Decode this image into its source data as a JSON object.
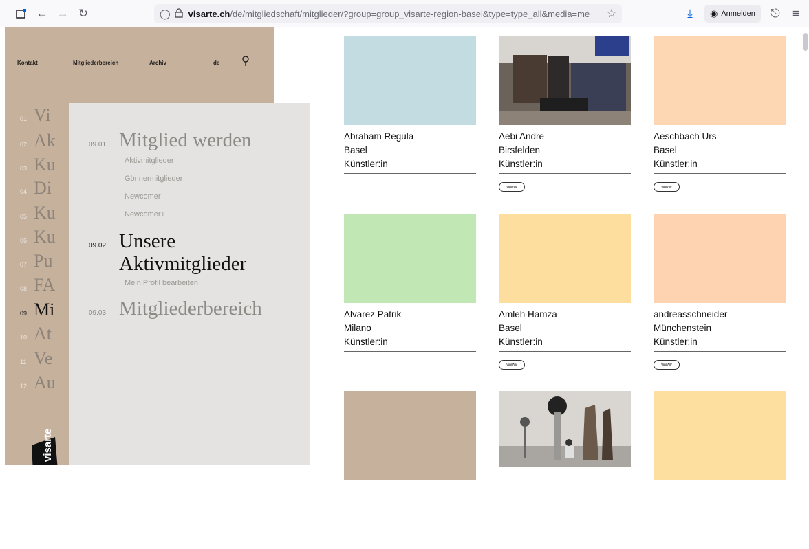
{
  "browser": {
    "url_host": "visarte.ch",
    "url_path": "/de/mitgliedschaft/mitglieder/?group=group_visarte-region-basel&type=type_all&media=me",
    "signin_label": "Anmelden"
  },
  "topnav": {
    "kontakt": "Kontakt",
    "mitgliederbereich": "Mitgliederbereich",
    "archiv": "Archiv",
    "lang": "de"
  },
  "menu": [
    {
      "num": "01",
      "label": "Vi"
    },
    {
      "num": "02",
      "label": "Ak"
    },
    {
      "num": "03",
      "label": "Ku"
    },
    {
      "num": "04",
      "label": "Di"
    },
    {
      "num": "05",
      "label": "Ku"
    },
    {
      "num": "06",
      "label": "Ku"
    },
    {
      "num": "07",
      "label": "Pu"
    },
    {
      "num": "08",
      "label": "FA"
    },
    {
      "num": "09",
      "label": "Mi"
    },
    {
      "num": "10",
      "label": "At"
    },
    {
      "num": "11",
      "label": "Ve"
    },
    {
      "num": "12",
      "label": "Au"
    }
  ],
  "logo_text": "visarte",
  "submenu": {
    "s1": {
      "num": "09.01",
      "label": "Mitglied werden"
    },
    "s1_items": [
      "Aktivmitglieder",
      "Gönnermitglieder",
      "Newcomer",
      "Newcomer+"
    ],
    "s2": {
      "num": "09.02",
      "label_line1": "Unsere",
      "label_line2": "Aktivmitglieder"
    },
    "s2_items": [
      "Mein Profil bearbeiten"
    ],
    "s3": {
      "num": "09.03",
      "label": "Mitgliederbereich"
    }
  },
  "members": [
    {
      "name": "Abraham Regula",
      "city": "Basel",
      "role": "Künstler:in",
      "www": "",
      "color": "#c3dce1"
    },
    {
      "name": "Aebi Andre",
      "city": "Birsfelden",
      "role": "Künstler:in",
      "www": "www",
      "color": "image"
    },
    {
      "name": "Aeschbach Urs",
      "city": "Basel",
      "role": "Künstler:in",
      "www": "www",
      "color": "#fdd6b3"
    },
    {
      "name": "Alvarez Patrik",
      "city": "Milano",
      "role": "Künstler:in",
      "www": "",
      "color": "#c1e7b4"
    },
    {
      "name": "Amleh Hamza",
      "city": "Basel",
      "role": "Künstler:in",
      "www": "www",
      "color": "#fdde9e"
    },
    {
      "name": "andreasschneider",
      "city": "Münchenstein",
      "role": "Künstler:in",
      "www": "www",
      "color": "#fdd3b1"
    },
    {
      "name": "",
      "city": "",
      "role": "",
      "www": "",
      "color": "#c6b19d"
    },
    {
      "name": "",
      "city": "",
      "role": "",
      "www": "",
      "color": "image"
    },
    {
      "name": "",
      "city": "",
      "role": "",
      "www": "",
      "color": "#fde09f"
    }
  ]
}
